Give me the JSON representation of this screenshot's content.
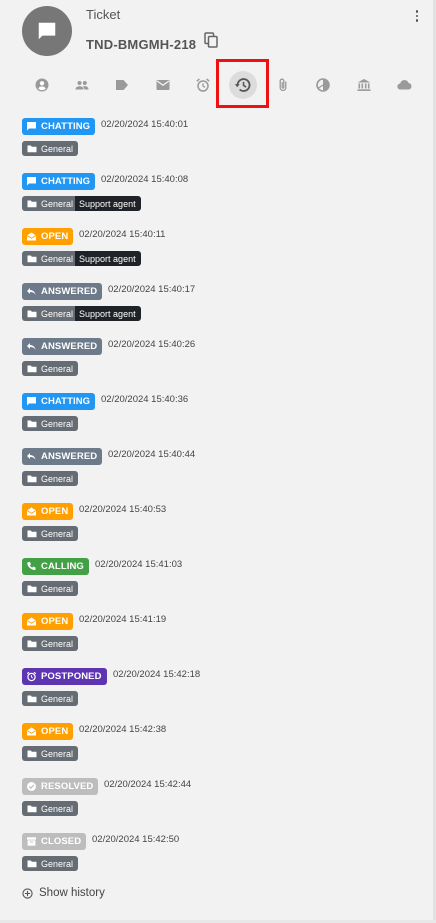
{
  "header": {
    "title": "Ticket",
    "ticket_id": "TND-BMGMH-218"
  },
  "tabs": [
    {
      "name": "tab-contact",
      "icon": "account-circle-icon"
    },
    {
      "name": "tab-group",
      "icon": "group-icon"
    },
    {
      "name": "tab-label",
      "icon": "label-icon"
    },
    {
      "name": "tab-email",
      "icon": "mail-icon"
    },
    {
      "name": "tab-alarm",
      "icon": "alarm-icon"
    },
    {
      "name": "tab-history",
      "icon": "history-icon",
      "active": true
    },
    {
      "name": "tab-attachments",
      "icon": "paperclip-icon"
    },
    {
      "name": "tab-pie",
      "icon": "pie-chart-icon"
    },
    {
      "name": "tab-bank",
      "icon": "bank-icon"
    },
    {
      "name": "tab-cloud",
      "icon": "cloud-icon"
    }
  ],
  "colors": {
    "chatting": "#2196f3",
    "open": "#ffa000",
    "answered": "#6c7a89",
    "calling": "#43a047",
    "postponed": "#5e35b1",
    "resolved": "#bdbdbd",
    "closed": "#bdbdbd",
    "highlight": "#ee1111"
  },
  "history": [
    {
      "status": "CHATTING",
      "kind": "chatting",
      "time": "02/20/2024 15:40:01",
      "tag": "General",
      "agent": ""
    },
    {
      "status": "CHATTING",
      "kind": "chatting",
      "time": "02/20/2024 15:40:08",
      "tag": "General",
      "agent": "Support agent"
    },
    {
      "status": "OPEN",
      "kind": "open",
      "time": "02/20/2024 15:40:11",
      "tag": "General",
      "agent": "Support agent"
    },
    {
      "status": "ANSWERED",
      "kind": "answered",
      "time": "02/20/2024 15:40:17",
      "tag": "General",
      "agent": "Support agent"
    },
    {
      "status": "ANSWERED",
      "kind": "answered",
      "time": "02/20/2024 15:40:26",
      "tag": "General",
      "agent": ""
    },
    {
      "status": "CHATTING",
      "kind": "chatting",
      "time": "02/20/2024 15:40:36",
      "tag": "General",
      "agent": ""
    },
    {
      "status": "ANSWERED",
      "kind": "answered",
      "time": "02/20/2024 15:40:44",
      "tag": "General",
      "agent": ""
    },
    {
      "status": "OPEN",
      "kind": "open",
      "time": "02/20/2024 15:40:53",
      "tag": "General",
      "agent": ""
    },
    {
      "status": "CALLING",
      "kind": "calling",
      "time": "02/20/2024 15:41:03",
      "tag": "General",
      "agent": ""
    },
    {
      "status": "OPEN",
      "kind": "open",
      "time": "02/20/2024 15:41:19",
      "tag": "General",
      "agent": ""
    },
    {
      "status": "POSTPONED",
      "kind": "postponed",
      "time": "02/20/2024 15:42:18",
      "tag": "General",
      "agent": ""
    },
    {
      "status": "OPEN",
      "kind": "open",
      "time": "02/20/2024 15:42:38",
      "tag": "General",
      "agent": ""
    },
    {
      "status": "RESOLVED",
      "kind": "resolved",
      "time": "02/20/2024 15:42:44",
      "tag": "General",
      "agent": ""
    },
    {
      "status": "CLOSED",
      "kind": "closed",
      "time": "02/20/2024 15:42:50",
      "tag": "General",
      "agent": ""
    }
  ],
  "footer": {
    "show_history_label": "Show history"
  }
}
